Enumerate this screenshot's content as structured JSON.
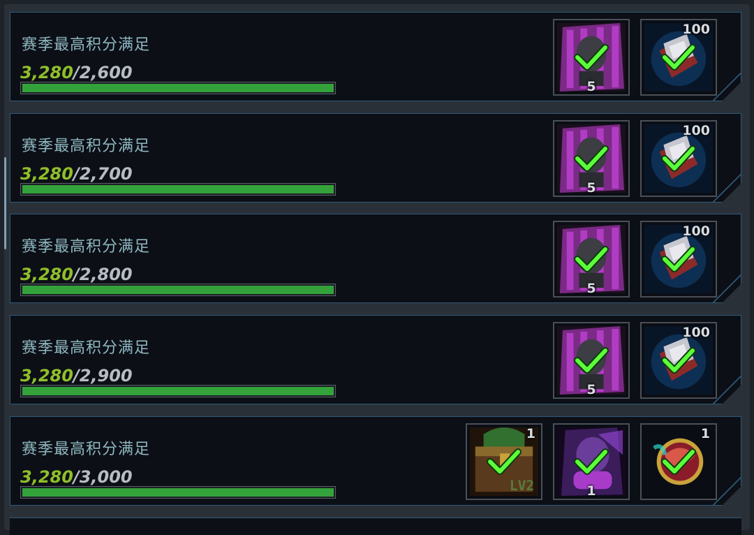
{
  "goals": [
    {
      "title": "赛季最高积分满足",
      "current": "3,280",
      "target": "/2,600",
      "progress": 1.0,
      "rewards": [
        {
          "icon": "pink-card-pack-icon",
          "count": "5",
          "count_pos": "bottom",
          "claimed": true
        },
        {
          "icon": "blue-token-bundle-icon",
          "count": "100",
          "count_pos": "topright",
          "claimed": true
        }
      ]
    },
    {
      "title": "赛季最高积分满足",
      "current": "3,280",
      "target": "/2,700",
      "progress": 1.0,
      "rewards": [
        {
          "icon": "pink-card-pack-icon",
          "count": "5",
          "count_pos": "bottom",
          "claimed": true
        },
        {
          "icon": "blue-token-bundle-icon",
          "count": "100",
          "count_pos": "topright",
          "claimed": true
        }
      ]
    },
    {
      "title": "赛季最高积分满足",
      "current": "3,280",
      "target": "/2,800",
      "progress": 1.0,
      "rewards": [
        {
          "icon": "pink-card-pack-icon",
          "count": "5",
          "count_pos": "bottom",
          "claimed": true
        },
        {
          "icon": "blue-token-bundle-icon",
          "count": "100",
          "count_pos": "topright",
          "claimed": true
        }
      ]
    },
    {
      "title": "赛季最高积分满足",
      "current": "3,280",
      "target": "/2,900",
      "progress": 1.0,
      "rewards": [
        {
          "icon": "pink-card-pack-icon",
          "count": "5",
          "count_pos": "bottom",
          "claimed": true
        },
        {
          "icon": "blue-token-bundle-icon",
          "count": "100",
          "count_pos": "topright",
          "claimed": true
        }
      ]
    },
    {
      "title": "赛季最高积分满足",
      "current": "3,280",
      "target": "/3,000",
      "progress": 1.0,
      "rewards": [
        {
          "icon": "lv2-treasure-chest-icon",
          "count": "1",
          "count_pos": "topright",
          "claimed": true
        },
        {
          "icon": "purple-card-icon",
          "count": "1",
          "count_pos": "bottom",
          "claimed": true
        },
        {
          "icon": "red-badge-medal-icon",
          "count": "1",
          "count_pos": "topright",
          "claimed": true
        }
      ]
    }
  ],
  "colors": {
    "accent_green": "#8fbf2a",
    "bar_green": "#34a23a",
    "check_green": "#5cff3a",
    "frame_blue": "#2f5a78"
  }
}
